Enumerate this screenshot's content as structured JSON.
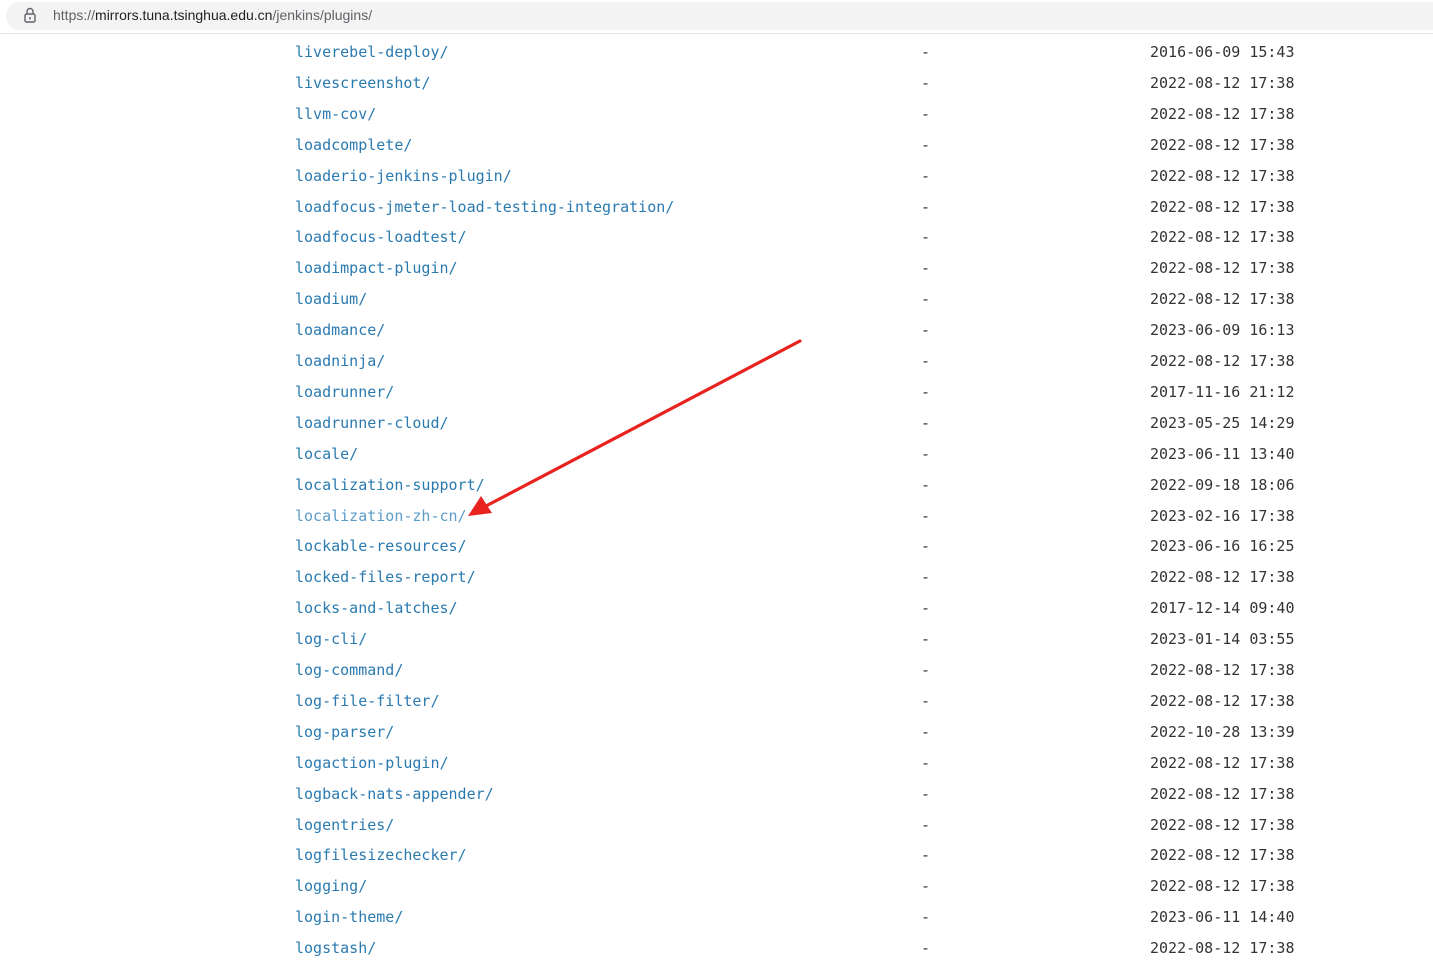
{
  "browser": {
    "url_protocol": "https://",
    "url_host": "mirrors.tuna.tsinghua.edu.cn",
    "url_path": "/jenkins/plugins/"
  },
  "listing": {
    "rows": [
      {
        "name": "liverebel-deploy/",
        "size": "-",
        "date": "2016-06-09 15:43"
      },
      {
        "name": "livescreenshot/",
        "size": "-",
        "date": "2022-08-12 17:38"
      },
      {
        "name": "llvm-cov/",
        "size": "-",
        "date": "2022-08-12 17:38"
      },
      {
        "name": "loadcomplete/",
        "size": "-",
        "date": "2022-08-12 17:38"
      },
      {
        "name": "loaderio-jenkins-plugin/",
        "size": "-",
        "date": "2022-08-12 17:38"
      },
      {
        "name": "loadfocus-jmeter-load-testing-integration/",
        "size": "-",
        "date": "2022-08-12 17:38"
      },
      {
        "name": "loadfocus-loadtest/",
        "size": "-",
        "date": "2022-08-12 17:38"
      },
      {
        "name": "loadimpact-plugin/",
        "size": "-",
        "date": "2022-08-12 17:38"
      },
      {
        "name": "loadium/",
        "size": "-",
        "date": "2022-08-12 17:38"
      },
      {
        "name": "loadmance/",
        "size": "-",
        "date": "2023-06-09 16:13"
      },
      {
        "name": "loadninja/",
        "size": "-",
        "date": "2022-08-12 17:38"
      },
      {
        "name": "loadrunner/",
        "size": "-",
        "date": "2017-11-16 21:12"
      },
      {
        "name": "loadrunner-cloud/",
        "size": "-",
        "date": "2023-05-25 14:29"
      },
      {
        "name": "locale/",
        "size": "-",
        "date": "2023-06-11 13:40"
      },
      {
        "name": "localization-support/",
        "size": "-",
        "date": "2022-09-18 18:06"
      },
      {
        "name": "localization-zh-cn/",
        "size": "-",
        "date": "2023-02-16 17:38",
        "visited": true
      },
      {
        "name": "lockable-resources/",
        "size": "-",
        "date": "2023-06-16 16:25"
      },
      {
        "name": "locked-files-report/",
        "size": "-",
        "date": "2022-08-12 17:38"
      },
      {
        "name": "locks-and-latches/",
        "size": "-",
        "date": "2017-12-14 09:40"
      },
      {
        "name": "log-cli/",
        "size": "-",
        "date": "2023-01-14 03:55"
      },
      {
        "name": "log-command/",
        "size": "-",
        "date": "2022-08-12 17:38"
      },
      {
        "name": "log-file-filter/",
        "size": "-",
        "date": "2022-08-12 17:38"
      },
      {
        "name": "log-parser/",
        "size": "-",
        "date": "2022-10-28 13:39"
      },
      {
        "name": "logaction-plugin/",
        "size": "-",
        "date": "2022-08-12 17:38"
      },
      {
        "name": "logback-nats-appender/",
        "size": "-",
        "date": "2022-08-12 17:38"
      },
      {
        "name": "logentries/",
        "size": "-",
        "date": "2022-08-12 17:38"
      },
      {
        "name": "logfilesizechecker/",
        "size": "-",
        "date": "2022-08-12 17:38"
      },
      {
        "name": "logging/",
        "size": "-",
        "date": "2022-08-12 17:38"
      },
      {
        "name": "login-theme/",
        "size": "-",
        "date": "2023-06-11 14:40"
      },
      {
        "name": "logstash/",
        "size": "-",
        "date": "2022-08-12 17:38"
      }
    ]
  },
  "annotation": {
    "arrow_color": "#e8231f",
    "points_to": "localization-zh-cn/"
  },
  "colors": {
    "link": "#2a7ab0",
    "link_visited": "#5b9cc9",
    "text": "#333333"
  }
}
